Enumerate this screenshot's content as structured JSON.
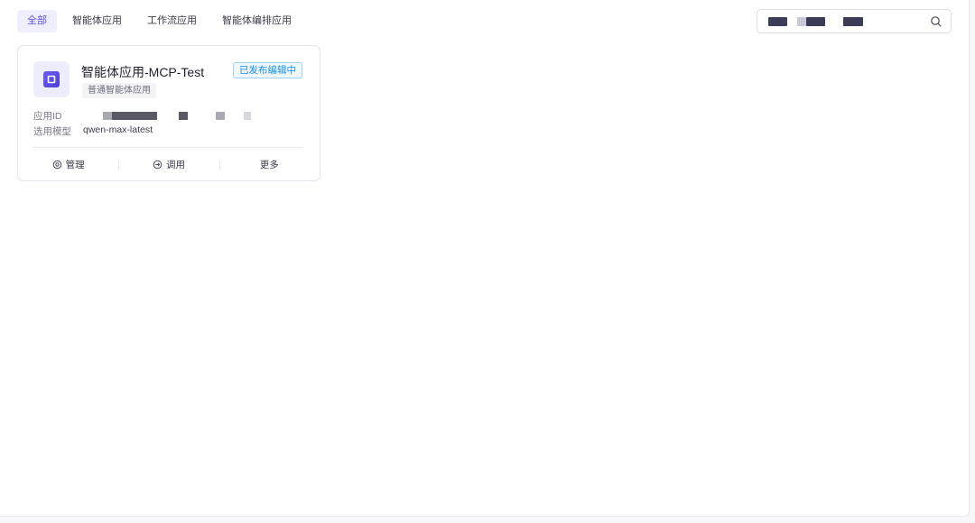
{
  "tabs": [
    {
      "label": "全部",
      "active": true
    },
    {
      "label": "智能体应用",
      "active": false
    },
    {
      "label": "工作流应用",
      "active": false
    },
    {
      "label": "智能体编排应用",
      "active": false
    }
  ],
  "search": {
    "value_redacted": true
  },
  "card": {
    "app_name": "智能体应用-MCP-Test",
    "status": "已发布编辑中",
    "type_tag": "普通智能体应用",
    "app_id_label": "应用ID",
    "model_label": "选用模型",
    "model_value": "qwen-max-latest",
    "actions": {
      "manage": "管理",
      "call": "调用",
      "more": "更多"
    }
  },
  "colors": {
    "accent": "#5b50e0",
    "badge_blue": "#1d8fe0"
  }
}
